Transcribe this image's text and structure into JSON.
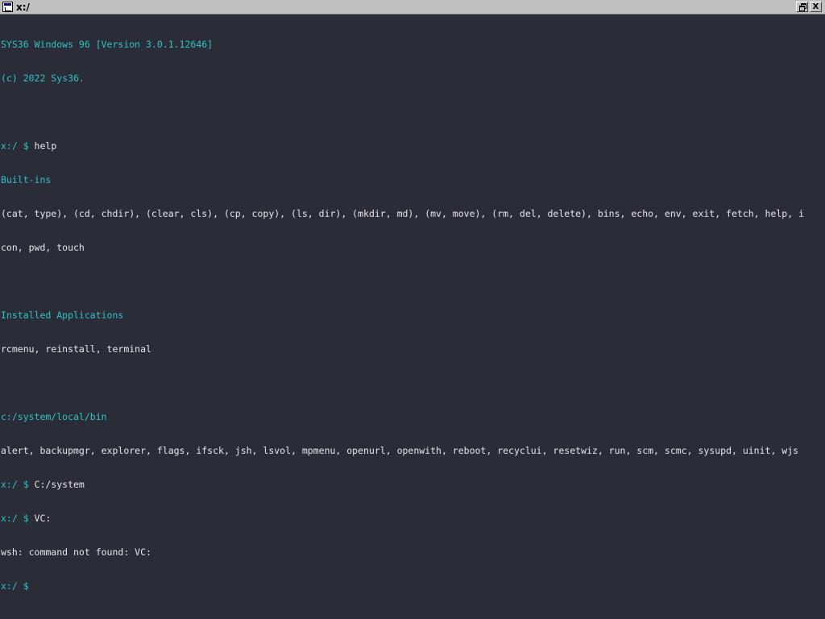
{
  "window": {
    "title": "x:/",
    "restore_label": "",
    "close_label": "X"
  },
  "colors": {
    "background": "#2a2c38",
    "accent": "#2ec4c4",
    "text": "#e6e6e6"
  },
  "terminal": {
    "banner_version": "SYS36 Windows 96 [Version 3.0.1.12646]",
    "banner_copyright": "(c) 2022 Sys36.",
    "prompt": "x:/ $ ",
    "cmd_help": "help",
    "builtins_heading": "Built-ins",
    "builtins_line1": "(cat, type), (cd, chdir), (clear, cls), (cp, copy), (ls, dir), (mkdir, md), (mv, move), (rm, del, delete), bins, echo, env, exit, fetch, help, i",
    "builtins_line2": "con, pwd, touch",
    "apps_heading": "Installed Applications",
    "apps_list": "rcmenu, reinstall, terminal",
    "bin_heading": "c:/system/local/bin",
    "bin_list": "alert, backupmgr, explorer, flags, ifsck, jsh, lsvol, mpmenu, openurl, openwith, reboot, recyclui, resetwiz, run, scm, scmc, sysupd, uinit, wjs",
    "cmd_system": "C:/system",
    "cmd_vc": "VC:",
    "error_msg": "wsh: command not found: VC:"
  }
}
